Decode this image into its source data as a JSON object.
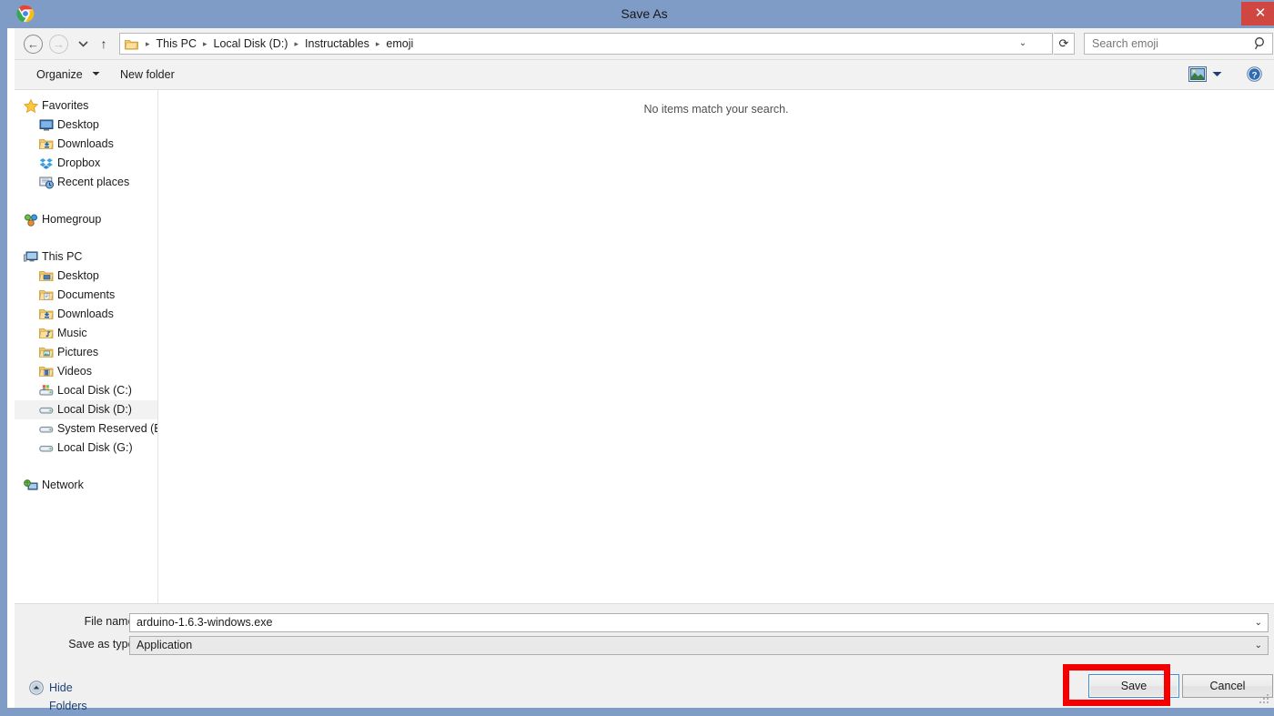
{
  "window": {
    "title": "Save As",
    "app_icon": "chrome-icon",
    "close_label": "✕",
    "accent_titlebar": "#7f9cc6",
    "close_button_color": "#cf4740"
  },
  "navbar": {
    "back_icon": "arrow-left-icon",
    "back_glyph": "←",
    "forward_icon": "arrow-right-icon",
    "forward_glyph": "→",
    "recent_icon": "chevron-down-icon",
    "recent_glyph": "▼",
    "up_icon": "arrow-up-icon",
    "up_glyph": "↑",
    "dropdown_glyph": "⌄",
    "refresh_icon": "refresh-icon",
    "refresh_glyph": "⟳",
    "breadcrumbs": [
      "This PC",
      "Local Disk (D:)",
      "Instructables",
      "emoji"
    ],
    "breadcrumb_separator": "▸",
    "search": {
      "placeholder": "Search emoji",
      "value": "",
      "icon": "search-icon"
    }
  },
  "toolbar": {
    "organize_label": "Organize",
    "organize_caret": "▼",
    "new_folder_label": "New folder",
    "view_icon": "preview-pane-icon",
    "view_caret": "▼",
    "help_icon": "help-icon",
    "help_glyph": "?"
  },
  "navpane": {
    "groups": [
      {
        "header": {
          "label": "Favorites",
          "icon": "star-icon",
          "level": 0
        },
        "items": [
          {
            "label": "Desktop",
            "icon": "desktop-icon",
            "level": 1
          },
          {
            "label": "Downloads",
            "icon": "downloads-folder-icon",
            "level": 1
          },
          {
            "label": "Dropbox",
            "icon": "dropbox-icon",
            "level": 1
          },
          {
            "label": "Recent places",
            "icon": "recent-places-icon",
            "level": 1
          }
        ]
      },
      {
        "header": {
          "label": "Homegroup",
          "icon": "homegroup-icon",
          "level": 0
        },
        "items": []
      },
      {
        "header": {
          "label": "This PC",
          "icon": "this-pc-icon",
          "level": 0
        },
        "items": [
          {
            "label": "Desktop",
            "icon": "desktop-folder-icon",
            "level": 1
          },
          {
            "label": "Documents",
            "icon": "documents-folder-icon",
            "level": 1
          },
          {
            "label": "Downloads",
            "icon": "downloads-folder-icon",
            "level": 1
          },
          {
            "label": "Music",
            "icon": "music-folder-icon",
            "level": 1
          },
          {
            "label": "Pictures",
            "icon": "pictures-folder-icon",
            "level": 1
          },
          {
            "label": "Videos",
            "icon": "videos-folder-icon",
            "level": 1
          },
          {
            "label": "Local Disk (C:)",
            "icon": "system-drive-icon",
            "level": 1
          },
          {
            "label": "Local Disk (D:)",
            "icon": "drive-icon",
            "level": 1,
            "selected": true
          },
          {
            "label": "System Reserved (E:",
            "icon": "drive-icon",
            "level": 1
          },
          {
            "label": "Local Disk (G:)",
            "icon": "drive-icon",
            "level": 1
          }
        ]
      },
      {
        "header": {
          "label": "Network",
          "icon": "network-icon",
          "level": 0
        },
        "items": []
      }
    ]
  },
  "filelist": {
    "empty_message": "No items match your search."
  },
  "bottom": {
    "file_name_label": "File name:",
    "file_name_value": "arduino-1.6.3-windows.exe",
    "save_type_label": "Save as type:",
    "save_type_value": "Application",
    "combo_caret": "⌄",
    "hide_folders_label": "Hide Folders",
    "hide_folders_icon": "chevron-up-circle-icon",
    "save_button_label": "Save",
    "cancel_button_label": "Cancel",
    "resize_grip_icon": "resize-grip-icon"
  },
  "annotation": {
    "color": "#f40000",
    "target": "save-button"
  }
}
